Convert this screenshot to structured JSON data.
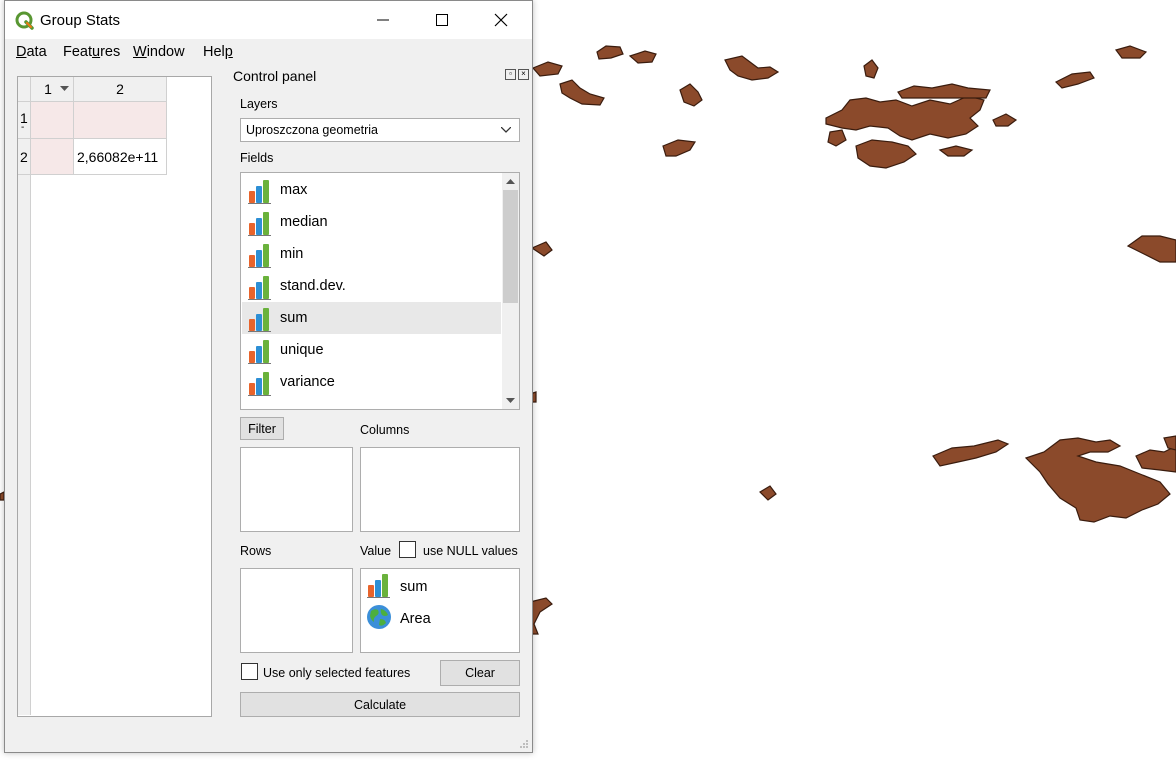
{
  "window": {
    "title": "Group Stats"
  },
  "menu": {
    "items": [
      {
        "label": "Data",
        "u": "D",
        "rest": "ata"
      },
      {
        "label": "Features",
        "u": "",
        "pre": "Feat",
        "mid": "u",
        "post": "res"
      },
      {
        "label": "Window",
        "pre": "",
        "mid": "W",
        "post": "indow"
      },
      {
        "label": "Help",
        "pre": "Hel",
        "mid": "p",
        "post": ""
      }
    ]
  },
  "table": {
    "col_headers": [
      "1",
      "2"
    ],
    "row_headers": [
      "1",
      "2"
    ],
    "row1_sub": "-",
    "cells": {
      "r2c2": "2,66082e+11"
    }
  },
  "panel": {
    "title": "Control panel",
    "layers_label": "Layers",
    "layer_value": "Uproszczona geometria",
    "fields_label": "Fields",
    "fields": [
      "max",
      "median",
      "min",
      "stand.dev.",
      "sum",
      "unique",
      "variance"
    ],
    "selected_field": "sum",
    "filter_button": "Filter",
    "columns_label": "Columns",
    "rows_label": "Rows",
    "value_label": "Value",
    "null_label": "use NULL values",
    "values": [
      {
        "label": "sum",
        "icon": "bar-chart-icon"
      },
      {
        "label": "Area",
        "icon": "globe-icon"
      }
    ],
    "selected_only_label": "Use only selected features",
    "clear_button": "Clear",
    "calculate_button": "Calculate"
  },
  "colors": {
    "feature_fill": "#8b4a2b",
    "feature_stroke": "#3a1c0e",
    "selected_row": "#e8e8e8",
    "table_pink": "#f6e8e8"
  }
}
